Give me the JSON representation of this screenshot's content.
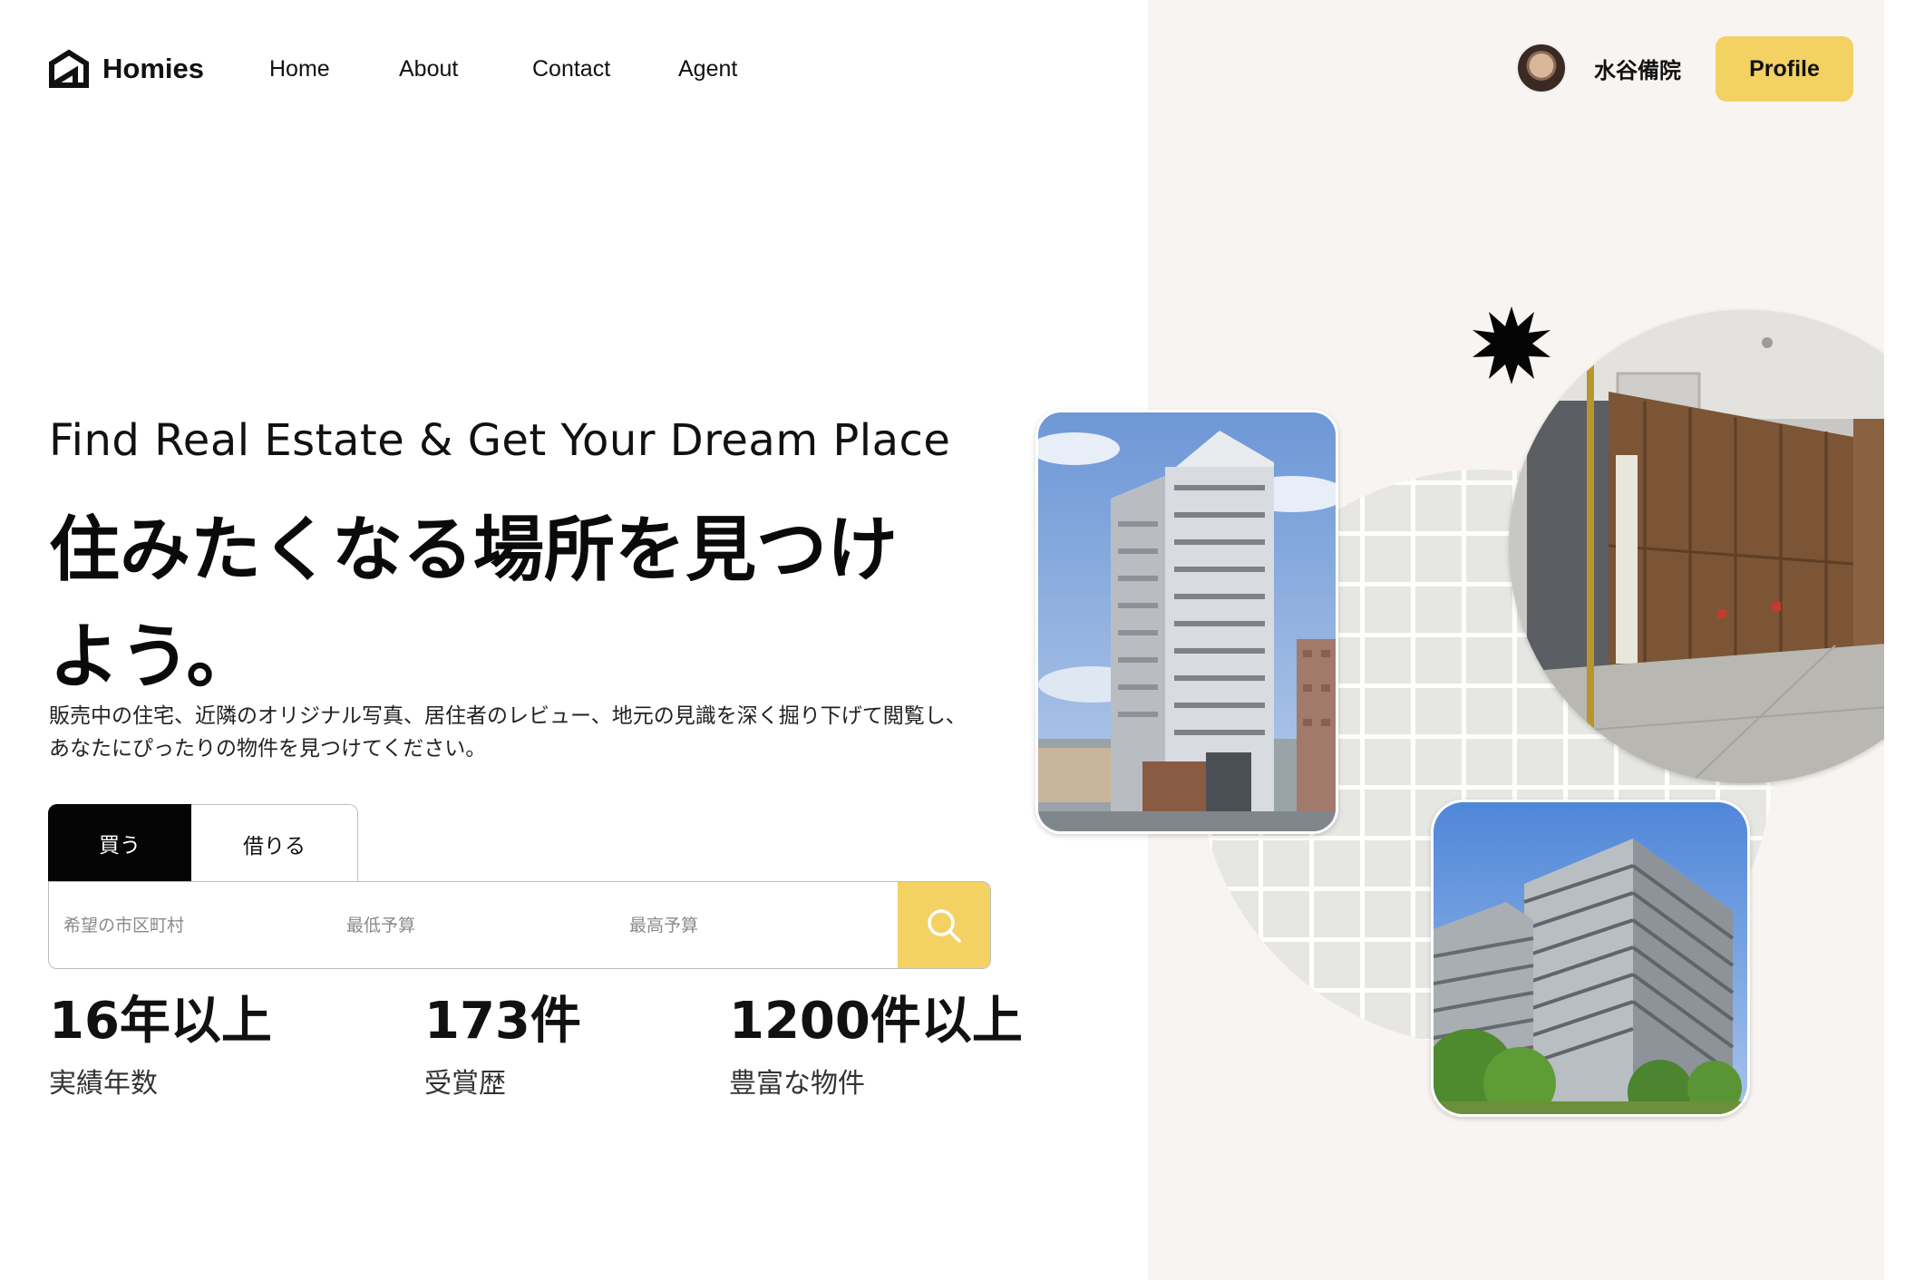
{
  "brand": {
    "name": "Homies"
  },
  "nav": {
    "items": [
      {
        "label": "Home"
      },
      {
        "label": "About"
      },
      {
        "label": "Contact"
      },
      {
        "label": "Agent"
      }
    ]
  },
  "user": {
    "name": "水谷備院",
    "profile_label": "Profile"
  },
  "hero": {
    "tagline": "Find Real Estate & Get Your Dream Place",
    "headline": "住みたくなる場所を見つけよう。",
    "description": "販売中の住宅、近隣のオリジナル写真、居住者のレビュー、地元の見識を深く掘り下げて閲覧し、 あなたにぴったりの物件を見つけてください。"
  },
  "search": {
    "tabs": [
      {
        "label": "買う",
        "active": true
      },
      {
        "label": "借りる",
        "active": false
      }
    ],
    "fields": [
      {
        "placeholder": "希望の市区町村"
      },
      {
        "placeholder": "最低予算"
      },
      {
        "placeholder": "最高予算"
      }
    ],
    "button_icon": "search-icon"
  },
  "stats": [
    {
      "value": "16年以上",
      "label": "実績年数"
    },
    {
      "value": "173件",
      "label": "受賞歴"
    },
    {
      "value": "1200件以上",
      "label": "豊富な物件"
    }
  ],
  "colors": {
    "accent": "#f3d163",
    "panel": "#f8f4f1",
    "dark": "#050505"
  }
}
